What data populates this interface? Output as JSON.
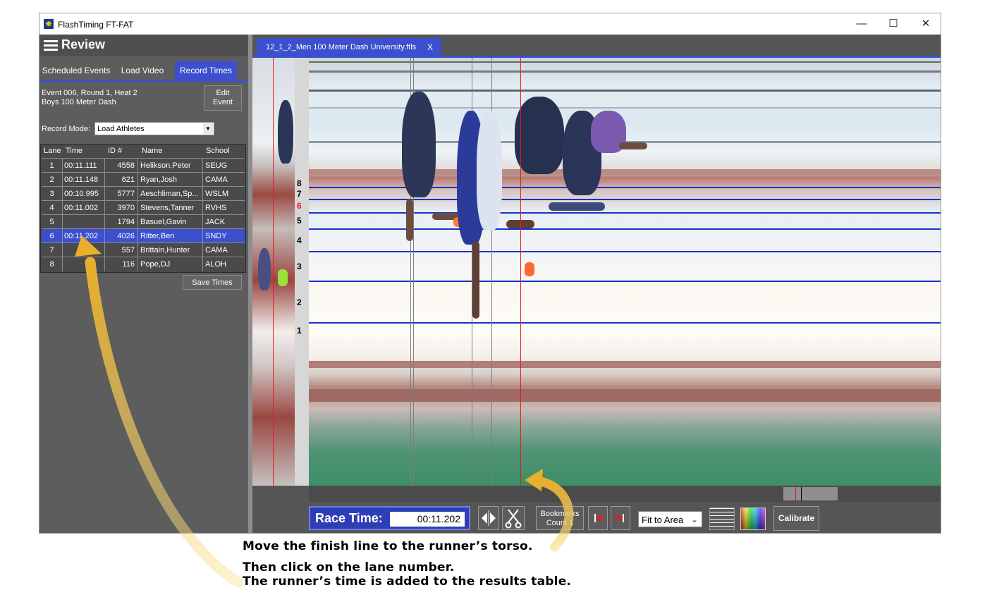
{
  "window": {
    "title": "FlashTiming FT-FAT",
    "controls": {
      "minimize": "—",
      "maximize": "☐",
      "close": "✕"
    }
  },
  "left_panel": {
    "header": "Review",
    "tabs": [
      {
        "label": "Scheduled Events",
        "active": false
      },
      {
        "label": "Load Video",
        "active": false
      },
      {
        "label": "Record Times",
        "active": true
      }
    ],
    "event": {
      "line1": "Event 006, Round 1, Heat 2",
      "line2": "Boys 100 Meter Dash"
    },
    "edit_event": {
      "line1": "Edit",
      "line2": "Event"
    },
    "record_mode": {
      "label": "Record Mode:",
      "value": "Load Athletes"
    },
    "columns": [
      "Lane",
      "Time",
      "ID #",
      "Name",
      "School"
    ],
    "rows": [
      {
        "lane": "1",
        "time": "00:11.111",
        "id": "4558",
        "name": "Helikson,Peter",
        "school": "SEUG"
      },
      {
        "lane": "2",
        "time": "00:11.148",
        "id": "621",
        "name": "Ryan,Josh",
        "school": "CAMA"
      },
      {
        "lane": "3",
        "time": "00:10.995",
        "id": "5777",
        "name": "Aeschliman,Sp...",
        "school": "WSLM"
      },
      {
        "lane": "4",
        "time": "00:11.002",
        "id": "3970",
        "name": "Stevens,Tanner",
        "school": "RVHS"
      },
      {
        "lane": "5",
        "time": "",
        "id": "1794",
        "name": "Basuel,Gavin",
        "school": "JACK"
      },
      {
        "lane": "6",
        "time": "00:11.202",
        "id": "4026",
        "name": "Ritter,Ben",
        "school": "SNDY"
      },
      {
        "lane": "7",
        "time": "",
        "id": "557",
        "name": "Brittain,Hunter",
        "school": "CAMA"
      },
      {
        "lane": "8",
        "time": "",
        "id": "116",
        "name": "Pope,DJ",
        "school": "ALOH"
      }
    ],
    "selected_lane": "6",
    "save_times": "Save Times"
  },
  "viewer": {
    "file_tab": {
      "name": "12_1_2_Men 100 Meter Dash University.ftls",
      "close": "X"
    },
    "lane_numbers": [
      "8",
      "7",
      "6",
      "5",
      "4",
      "3",
      "2",
      "1"
    ],
    "highlighted_lane": "6",
    "colors": {
      "accent": "#3b4fcf",
      "lane_divider": "#1733c9",
      "finish_line": "#e21d1d",
      "highlight_lane_text": "#e21d1d"
    }
  },
  "toolbar": {
    "race_time_label": "Race Time:",
    "race_time_value": "00:11.202",
    "move_line_icon": "move-line-icon",
    "scissors_icon": "scissors-icon",
    "bookmarks": {
      "line1": "Bookmarks",
      "line2": "Count 1"
    },
    "prev_icon": "prev-bookmark-icon",
    "next_icon": "next-bookmark-icon",
    "fit_option": "Fit to Area",
    "calibrate": "Calibrate"
  },
  "annotations": {
    "line1": "Move the finish line to the runner’s torso.",
    "line2": "Then click on the lane number.",
    "line3": "The runner’s time is added to the results table."
  }
}
